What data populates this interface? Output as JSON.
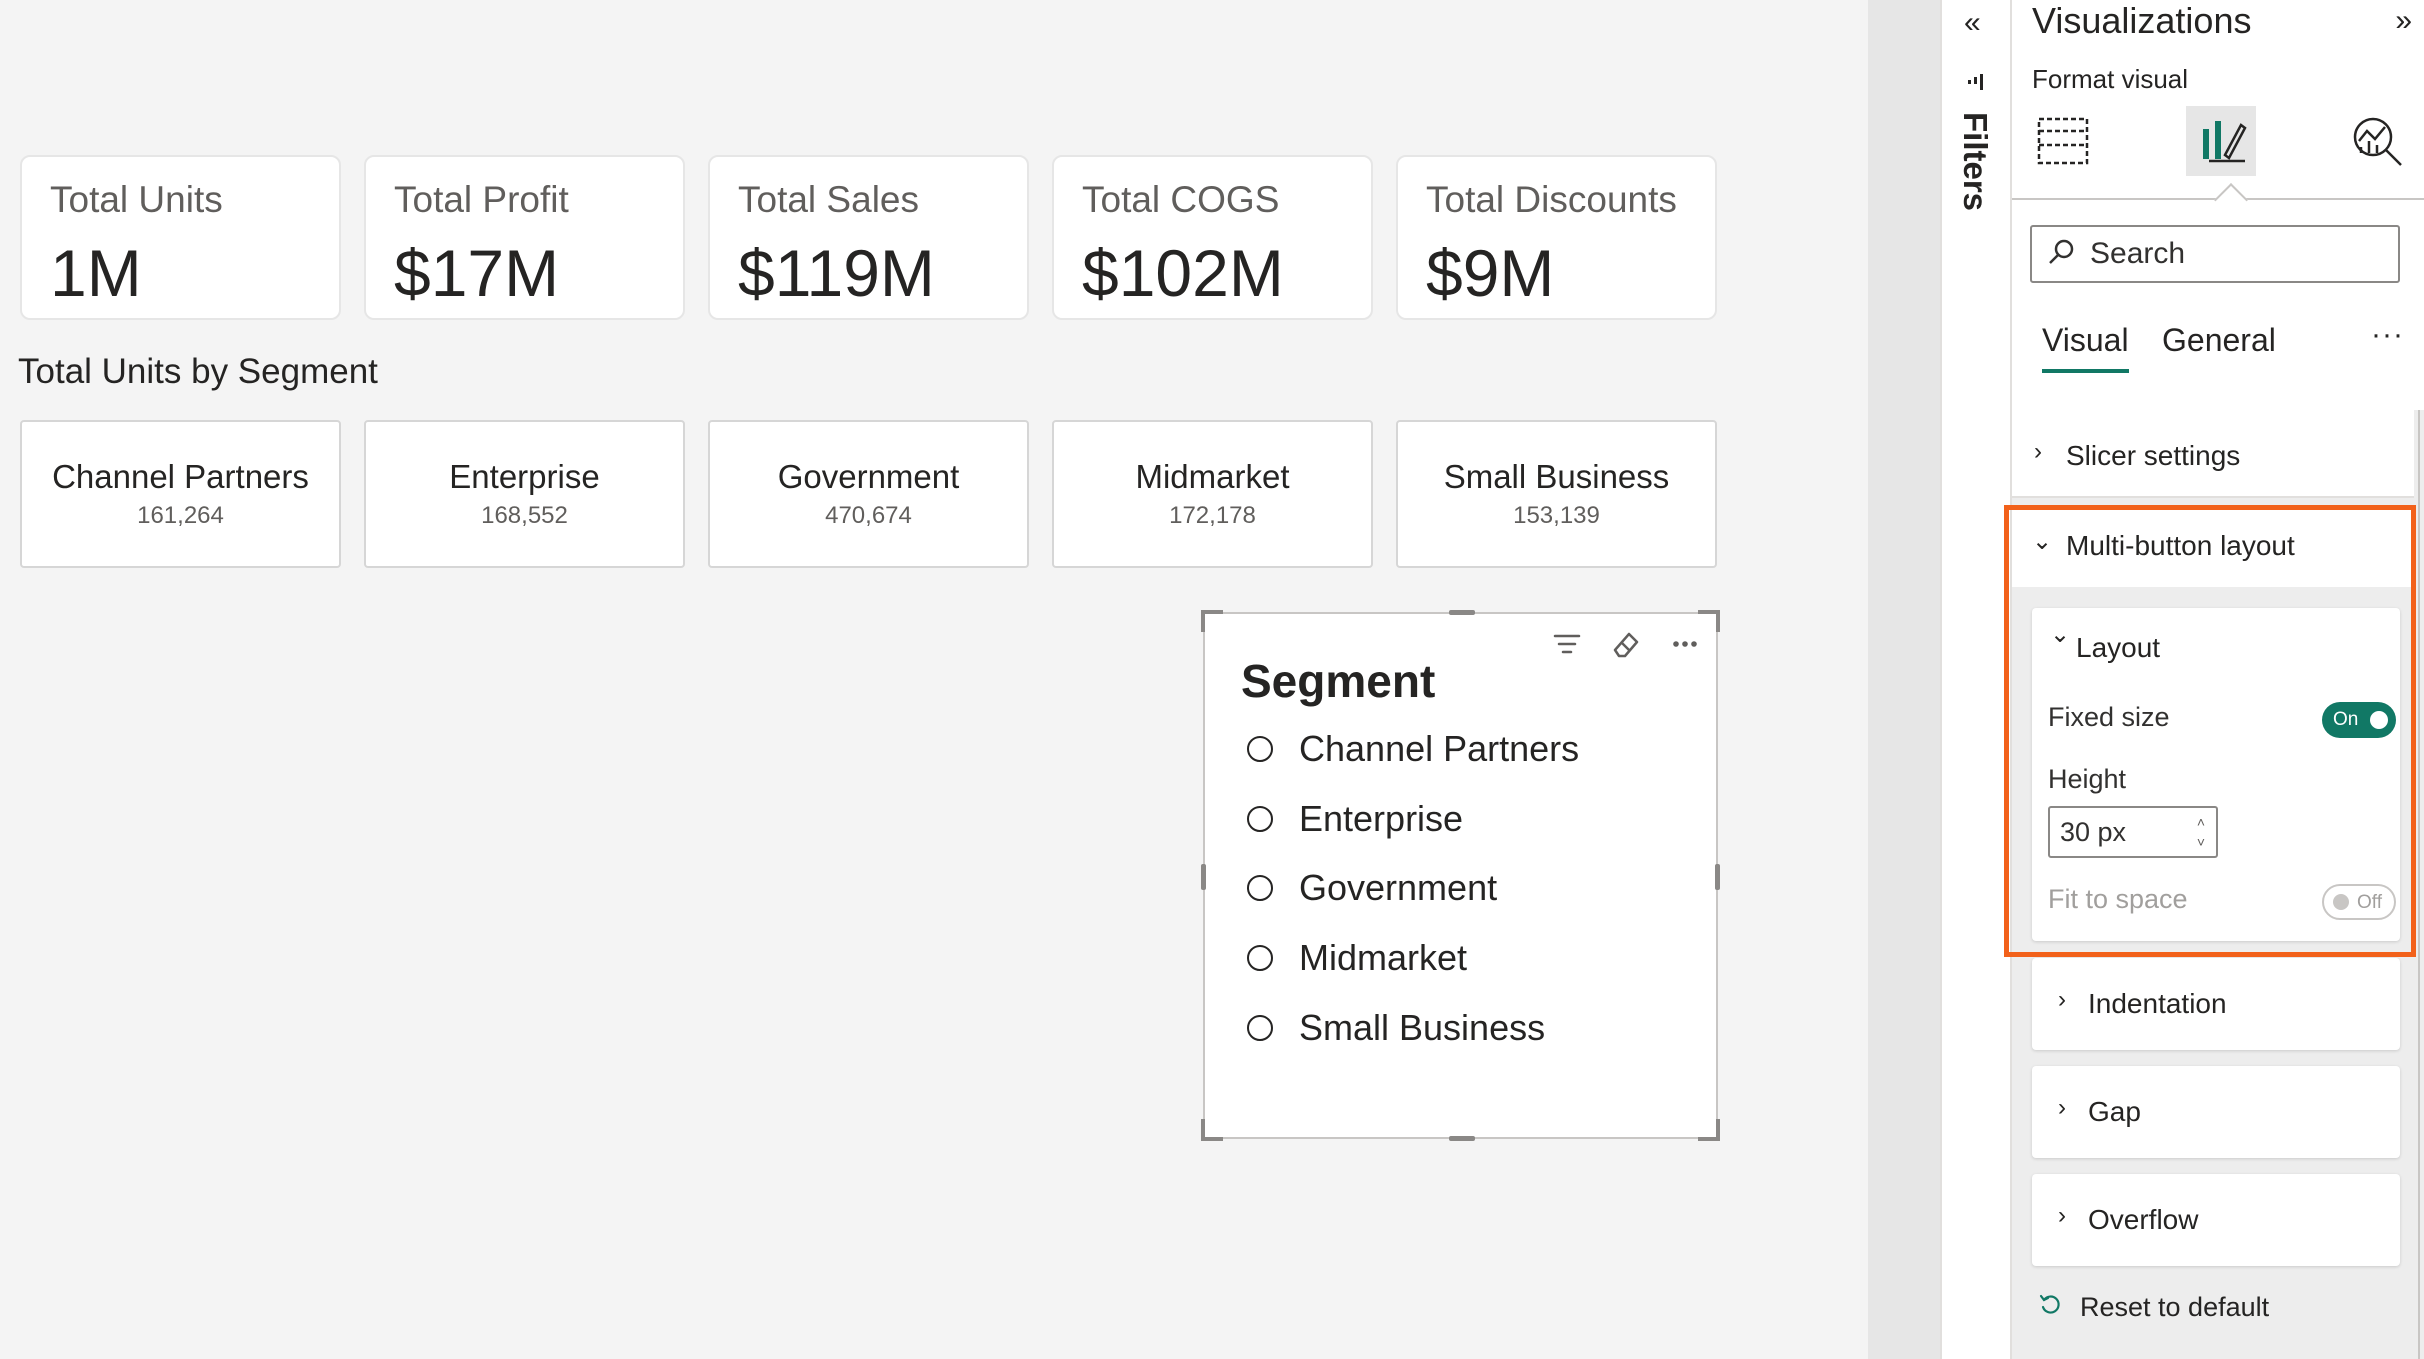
{
  "kpis": [
    {
      "label": "Total Units",
      "value": "1M"
    },
    {
      "label": "Total Profit",
      "value": "$17M"
    },
    {
      "label": "Total Sales",
      "value": "$119M"
    },
    {
      "label": "Total COGS",
      "value": "$102M"
    },
    {
      "label": "Total Discounts",
      "value": "$9M"
    }
  ],
  "segment_section": {
    "title": "Total Units by Segment",
    "cards": [
      {
        "name": "Channel Partners",
        "value": "161,264"
      },
      {
        "name": "Enterprise",
        "value": "168,552"
      },
      {
        "name": "Government",
        "value": "470,674"
      },
      {
        "name": "Midmarket",
        "value": "172,178"
      },
      {
        "name": "Small Business",
        "value": "153,139"
      }
    ]
  },
  "slicer": {
    "title": "Segment",
    "items": [
      "Channel Partners",
      "Enterprise",
      "Government",
      "Midmarket",
      "Small Business"
    ]
  },
  "filters_pane": {
    "label": "Filters"
  },
  "viz_pane": {
    "title": "Visualizations",
    "subtitle": "Format visual",
    "search_placeholder": "Search",
    "tabs": [
      "Visual",
      "General"
    ],
    "active_tab": "Visual",
    "sections": {
      "slicer_settings": "Slicer settings",
      "multi_button_layout": "Multi-button layout",
      "layout": "Layout",
      "fixed_size": "Fixed size",
      "fixed_size_state": "On",
      "height_label": "Height",
      "height_value": "30 px",
      "fit_to_space": "Fit to space",
      "fit_to_space_state": "Off",
      "indentation": "Indentation",
      "gap": "Gap",
      "overflow": "Overflow"
    },
    "reset_label": "Reset to default"
  },
  "colors": {
    "accent": "#117865",
    "highlight": "#f2611a",
    "canvas_bg": "#f4f4f4"
  }
}
